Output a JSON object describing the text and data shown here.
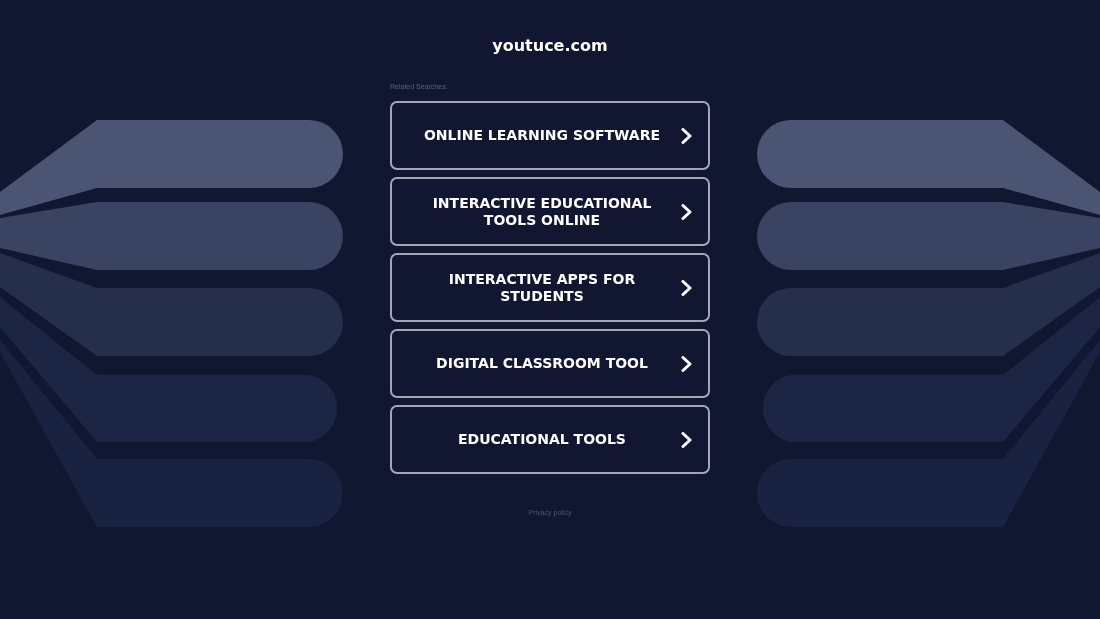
{
  "site": {
    "title": "youtuce.com"
  },
  "related_searches": {
    "label": "Related Searches:",
    "items": [
      "ONLINE LEARNING SOFTWARE",
      "INTERACTIVE EDUCATIONAL TOOLS ONLINE",
      "INTERACTIVE APPS FOR STUDENTS",
      "DIGITAL CLASSROOM TOOL",
      "EDUCATIONAL TOOLS"
    ]
  },
  "footer": {
    "privacy_link": "Privacy policy"
  }
}
